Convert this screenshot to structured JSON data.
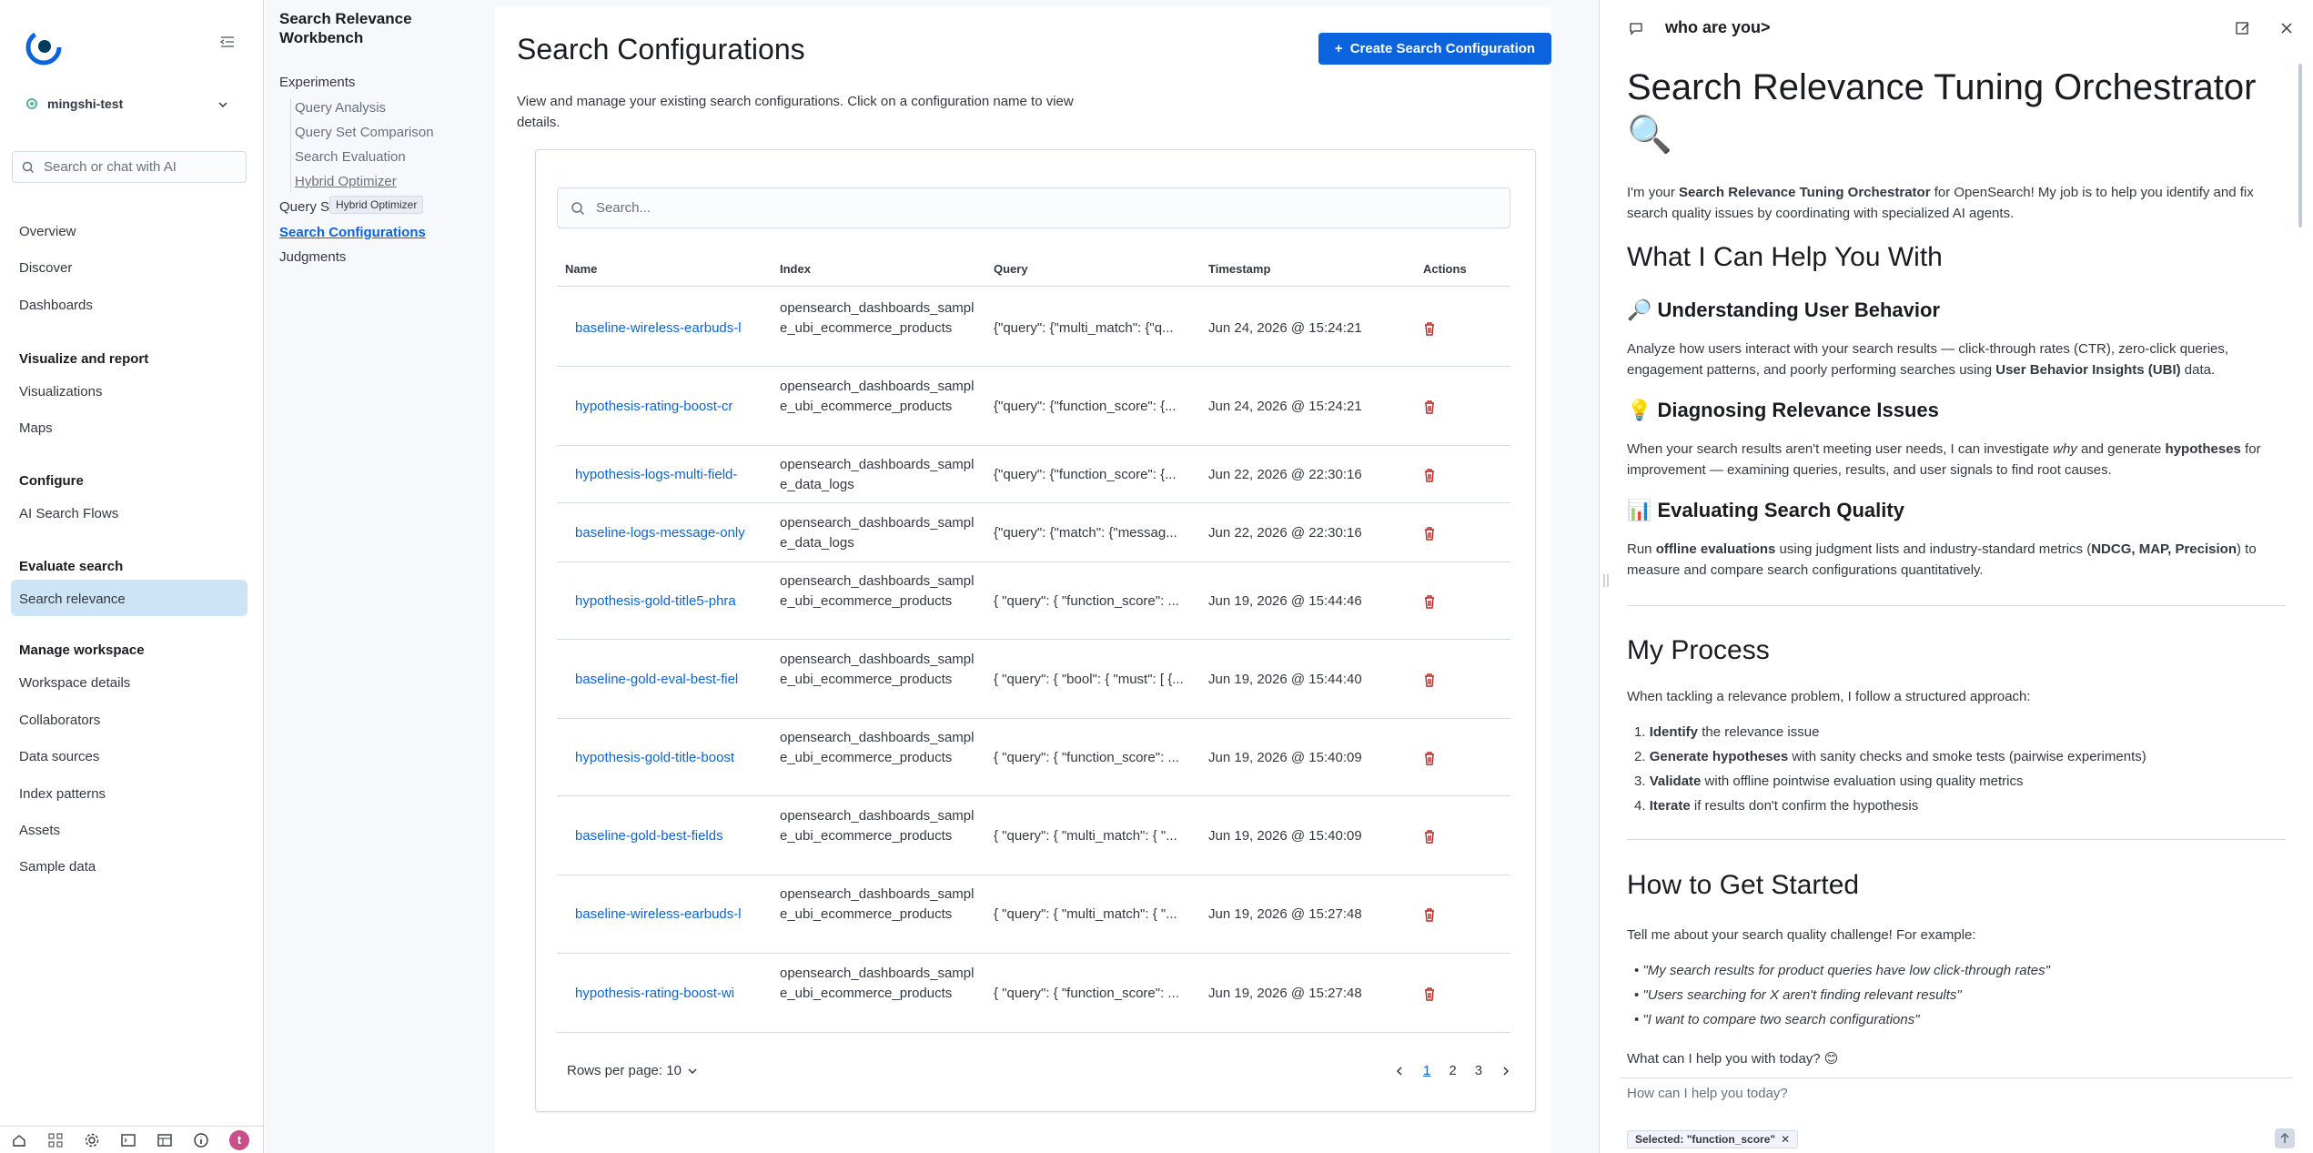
{
  "leftnav": {
    "workspace": "mingshi-test",
    "search_placeholder": "Search or chat with AI",
    "items_top": [
      "Overview",
      "Discover",
      "Dashboards"
    ],
    "section_visualize": "Visualize and report",
    "items_visualize": [
      "Visualizations",
      "Maps"
    ],
    "section_configure": "Configure",
    "items_configure": [
      "AI Search Flows"
    ],
    "section_evaluate": "Evaluate search",
    "items_evaluate": [
      "Search relevance"
    ],
    "section_manage": "Manage workspace",
    "items_manage": [
      "Workspace details",
      "Collaborators",
      "Data sources",
      "Index patterns",
      "Assets",
      "Sample data"
    ],
    "avatar_letter": "t"
  },
  "appsidebar": {
    "title": "Search Relevance Workbench",
    "experiments": "Experiments",
    "sub": [
      "Query Analysis",
      "Query Set Comparison",
      "Search Evaluation",
      "Hybrid Optimizer"
    ],
    "query_sets": "Query S",
    "search_configurations": "Search Configurations",
    "judgments": "Judgments",
    "tooltip": "Hybrid Optimizer"
  },
  "main": {
    "title": "Search Configurations",
    "create_button": "Create Search Configuration",
    "description": "View and manage your existing search configurations. Click on a configuration name to view details.",
    "search_placeholder": "Search...",
    "columns": [
      "Name",
      "Index",
      "Query",
      "Timestamp",
      "Actions"
    ],
    "rows": [
      {
        "name": "baseline-wireless-earbuds-l",
        "index": "opensearch_dashboards_sample_ubi_ecommerce_products",
        "query": "{\"query\": {\"multi_match\": {\"q...",
        "ts": "Jun 24, 2026 @ 15:24:21"
      },
      {
        "name": "hypothesis-rating-boost-cr",
        "index": "opensearch_dashboards_sample_ubi_ecommerce_products",
        "query": "{\"query\": {\"function_score\": {...",
        "ts": "Jun 24, 2026 @ 15:24:21"
      },
      {
        "name": "hypothesis-logs-multi-field-",
        "index": "opensearch_dashboards_sample_data_logs",
        "query": "{\"query\": {\"function_score\": {...",
        "ts": "Jun 22, 2026 @ 22:30:16"
      },
      {
        "name": "baseline-logs-message-only",
        "index": "opensearch_dashboards_sample_data_logs",
        "query": "{\"query\": {\"match\": {\"messag...",
        "ts": "Jun 22, 2026 @ 22:30:16"
      },
      {
        "name": "hypothesis-gold-title5-phra",
        "index": "opensearch_dashboards_sample_ubi_ecommerce_products",
        "query": "{ \"query\": { \"function_score\": ...",
        "ts": "Jun 19, 2026 @ 15:44:46"
      },
      {
        "name": "baseline-gold-eval-best-fiel",
        "index": "opensearch_dashboards_sample_ubi_ecommerce_products",
        "query": "{ \"query\": { \"bool\": { \"must\": [ {...",
        "ts": "Jun 19, 2026 @ 15:44:40"
      },
      {
        "name": "hypothesis-gold-title-boost",
        "index": "opensearch_dashboards_sample_ubi_ecommerce_products",
        "query": "{ \"query\": { \"function_score\": ...",
        "ts": "Jun 19, 2026 @ 15:40:09"
      },
      {
        "name": "baseline-gold-best-fields",
        "index": "opensearch_dashboards_sample_ubi_ecommerce_products",
        "query": "{ \"query\": { \"multi_match\": { \"...",
        "ts": "Jun 19, 2026 @ 15:40:09"
      },
      {
        "name": "baseline-wireless-earbuds-l",
        "index": "opensearch_dashboards_sample_ubi_ecommerce_products",
        "query": "{ \"query\": { \"multi_match\": { \"...",
        "ts": "Jun 19, 2026 @ 15:27:48"
      },
      {
        "name": "hypothesis-rating-boost-wi",
        "index": "opensearch_dashboards_sample_ubi_ecommerce_products",
        "query": "{ \"query\": { \"function_score\": ...",
        "ts": "Jun 19, 2026 @ 15:27:48"
      }
    ],
    "rows_per_page": "Rows per page: 10",
    "pages": [
      "1",
      "2",
      "3"
    ]
  },
  "chat": {
    "title": "who are you>",
    "h1": "Search Relevance Tuning Orchestrator 🔍",
    "intro_pre": "I'm your ",
    "intro_bold": "Search Relevance Tuning Orchestrator",
    "intro_post": " for OpenSearch! My job is to help you identify and fix search quality issues by coordinating with specialized AI agents.",
    "h2_help": "What I Can Help You With",
    "h3_behavior": "🔎 Understanding User Behavior",
    "p_behavior_pre": "Analyze how users interact with your search results — click-through rates (CTR), zero-click queries, engagement patterns, and poorly performing searches using ",
    "p_behavior_bold": "User Behavior Insights (UBI)",
    "p_behavior_post": " data.",
    "h3_diagnose": "💡 Diagnosing Relevance Issues",
    "p_diag_1": "When your search results aren't meeting user needs, I can investigate ",
    "p_diag_why": "why",
    "p_diag_2": " and generate ",
    "p_diag_hyp": "hypotheses",
    "p_diag_3": " for improvement — examining queries, results, and user signals to find root causes.",
    "h3_eval": "📊 Evaluating Search Quality",
    "p_eval_1": "Run ",
    "p_eval_off": "offline evaluations",
    "p_eval_2": " using judgment lists and industry-standard metrics (",
    "p_eval_metrics": "NDCG, MAP, Precision",
    "p_eval_3": ") to measure and compare search configurations quantitatively.",
    "h2_process": "My Process",
    "p_process": "When tackling a relevance problem, I follow a structured approach:",
    "steps": [
      {
        "bold": "Identify",
        "rest": " the relevance issue"
      },
      {
        "bold": "Generate hypotheses",
        "rest": " with sanity checks and smoke tests (pairwise experiments)"
      },
      {
        "bold": "Validate",
        "rest": " with offline pointwise evaluation using quality metrics"
      },
      {
        "bold": "Iterate",
        "rest": " if results don't confirm the hypothesis"
      }
    ],
    "h2_start": "How to Get Started",
    "p_start": "Tell me about your search quality challenge! For example:",
    "examples": [
      "\"My search results for product queries have low click-through rates\"",
      "\"Users searching for X aren't finding relevant results\"",
      "\"I want to compare two search configurations\""
    ],
    "closing": "What can I help you with today? 😊",
    "input_placeholder": "How can I help you today?",
    "chip": "Selected: \"function_score\""
  }
}
